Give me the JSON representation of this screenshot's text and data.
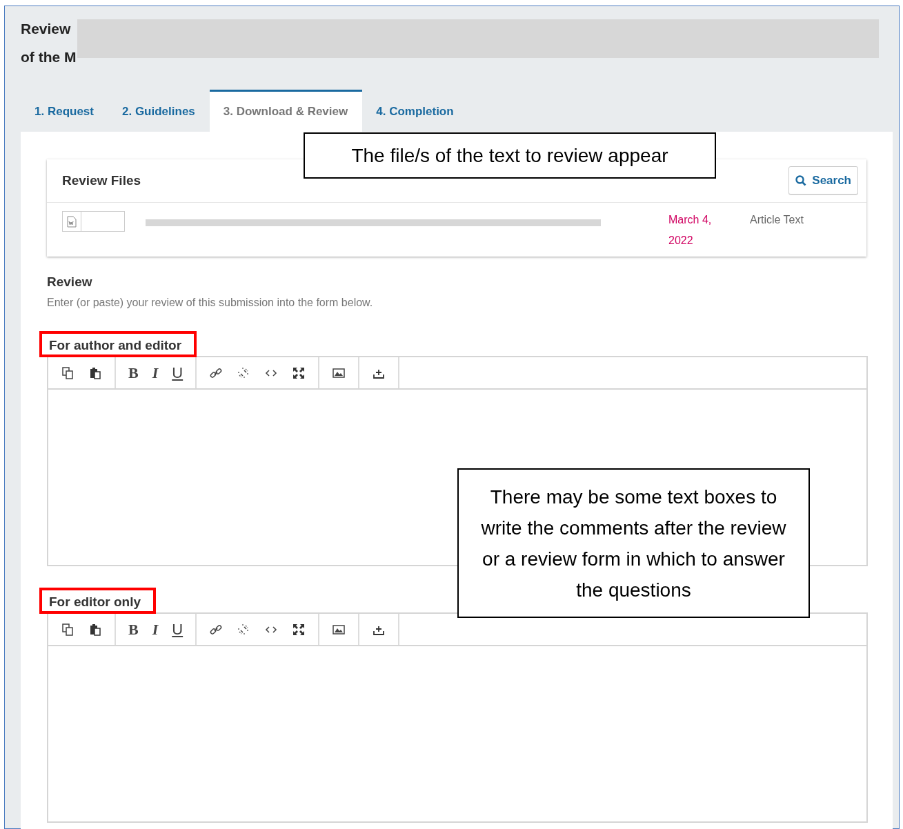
{
  "title_lines": [
    "Review",
    "of the M"
  ],
  "tabs": [
    {
      "label": "1. Request",
      "selected": false
    },
    {
      "label": "2. Guidelines",
      "selected": false
    },
    {
      "label": "3. Download & Review",
      "selected": true
    },
    {
      "label": "4. Completion",
      "selected": false
    }
  ],
  "review_files": {
    "heading": "Review Files",
    "search_button": "Search",
    "files": [
      {
        "date": "March 4, 2022",
        "type": "Article Text"
      }
    ]
  },
  "review": {
    "heading": "Review",
    "description": "Enter (or paste) your review of this submission into the form below."
  },
  "editors": [
    {
      "label": "For author and editor",
      "highlighted": true,
      "toolbar": [
        {
          "kind": "copy"
        },
        {
          "kind": "paste"
        },
        {
          "kind": "bold",
          "glyph": "B"
        },
        {
          "kind": "italic",
          "glyph": "I"
        },
        {
          "kind": "underline",
          "glyph": "U"
        },
        {
          "kind": "link"
        },
        {
          "kind": "unlink"
        },
        {
          "kind": "code"
        },
        {
          "kind": "fullscreen"
        },
        {
          "kind": "image"
        },
        {
          "kind": "upload"
        }
      ]
    },
    {
      "label": "For editor only",
      "highlighted": true,
      "toolbar": [
        {
          "kind": "copy"
        },
        {
          "kind": "paste"
        },
        {
          "kind": "bold",
          "glyph": "B"
        },
        {
          "kind": "italic",
          "glyph": "I"
        },
        {
          "kind": "underline",
          "glyph": "U"
        },
        {
          "kind": "link"
        },
        {
          "kind": "unlink"
        },
        {
          "kind": "code"
        },
        {
          "kind": "fullscreen"
        },
        {
          "kind": "image"
        },
        {
          "kind": "upload"
        }
      ]
    }
  ],
  "callouts": [
    {
      "text": "The file/s of the text to review appear"
    },
    {
      "text": "There may be some text boxes to write the comments after the review or a review form in which to answer the questions"
    }
  ]
}
